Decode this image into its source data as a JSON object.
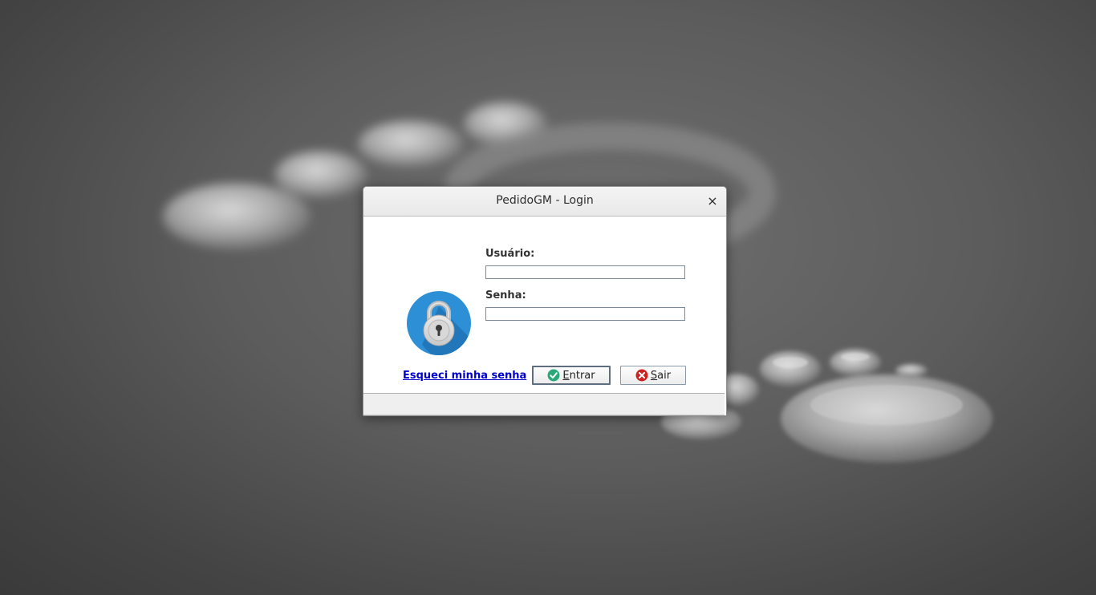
{
  "window": {
    "title": "PedidoGM - Login",
    "close_glyph": "×"
  },
  "form": {
    "user_label": "Usuário:",
    "user_value": "",
    "password_label": "Senha:",
    "password_value": "",
    "forgot_link": "Esqueci minha senha",
    "enter_button": {
      "mnemonic": "E",
      "rest": "ntrar",
      "icon": "check-circle-icon"
    },
    "exit_button": {
      "mnemonic": "S",
      "rest": "air",
      "icon": "x-circle-icon"
    }
  },
  "icons": {
    "lock": "padlock-icon"
  },
  "colors": {
    "lock_circle": "#2d8fd6",
    "link": "#0000cc",
    "enter_icon": "#2aa87a",
    "exit_icon": "#cc2222"
  }
}
